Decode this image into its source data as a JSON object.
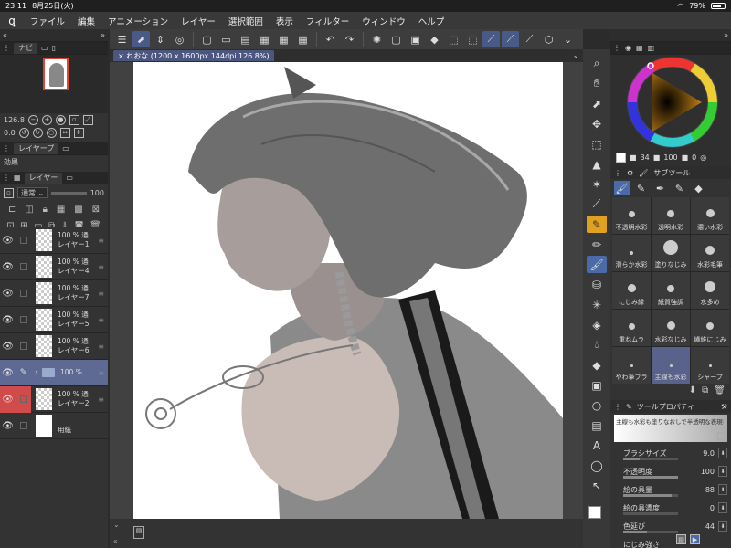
{
  "status_bar": {
    "time": "23:11",
    "date": "8月25日(火)",
    "battery": "79%",
    "battery_level": 0.79
  },
  "menu": {
    "items": [
      "ファイル",
      "編集",
      "アニメーション",
      "レイヤー",
      "選択範囲",
      "表示",
      "フィルター",
      "ウィンドウ",
      "ヘルプ"
    ]
  },
  "canvas": {
    "tab_title": "れおな (1200 x 1600px 144dpi 126.8%)"
  },
  "navigator": {
    "tab_label": "ナビ",
    "zoom": "126.8",
    "rotation": "0.0"
  },
  "layer_property": {
    "tab_label": "レイヤープ",
    "effect_label": "効果"
  },
  "layer_panel": {
    "tab_label": "レイヤー",
    "blend_mode": "通常",
    "opacity": "100",
    "layers": [
      {
        "opacity": "100 %",
        "blend": "通",
        "name": "レイヤー1"
      },
      {
        "opacity": "100 %",
        "blend": "通",
        "name": "レイヤー4"
      },
      {
        "opacity": "100 %",
        "blend": "通",
        "name": "レイヤー7"
      },
      {
        "opacity": "100 %",
        "blend": "通",
        "name": "レイヤー5"
      },
      {
        "opacity": "100 %",
        "blend": "通",
        "name": "レイヤー6"
      },
      {
        "opacity": "100 %",
        "blend": "",
        "name": ""
      },
      {
        "opacity": "100 %",
        "blend": "通",
        "name": "レイヤー2"
      },
      {
        "opacity": "",
        "blend": "",
        "name": "用紙"
      }
    ]
  },
  "color": {
    "hue_value": "34",
    "sat_value": "100",
    "val_value": "0",
    "fg": "#ffffff",
    "bg": "#4a6aa8"
  },
  "subtool": {
    "tab_label": "サブツール",
    "brushes": [
      "不透明水彩",
      "透明水彩",
      "濃い水彩",
      "滑らか水彩",
      "塗りなじみ",
      "水彩毛筆",
      "にじみ縁",
      "紙質強調",
      "水多め",
      "重ねムラ",
      "水彩なじみ",
      "繊維にじみ",
      "やわ筆ブラ",
      "主線も水彩",
      "シャープ"
    ],
    "selected_index": 13
  },
  "tool_property": {
    "tab_label": "ツールプロパティ",
    "preview_text": "主線も水彩も塗りなおしで半透明な表現を描けるものです",
    "rows": [
      {
        "label": "ブラシサイズ",
        "value": "9.0"
      },
      {
        "label": "不透明度",
        "value": "100"
      },
      {
        "label": "絵の具量",
        "value": "88"
      },
      {
        "label": "絵の具濃度",
        "value": "0"
      },
      {
        "label": "色延び",
        "value": "44"
      },
      {
        "label": "にじみ強さ",
        "value": ""
      }
    ]
  }
}
